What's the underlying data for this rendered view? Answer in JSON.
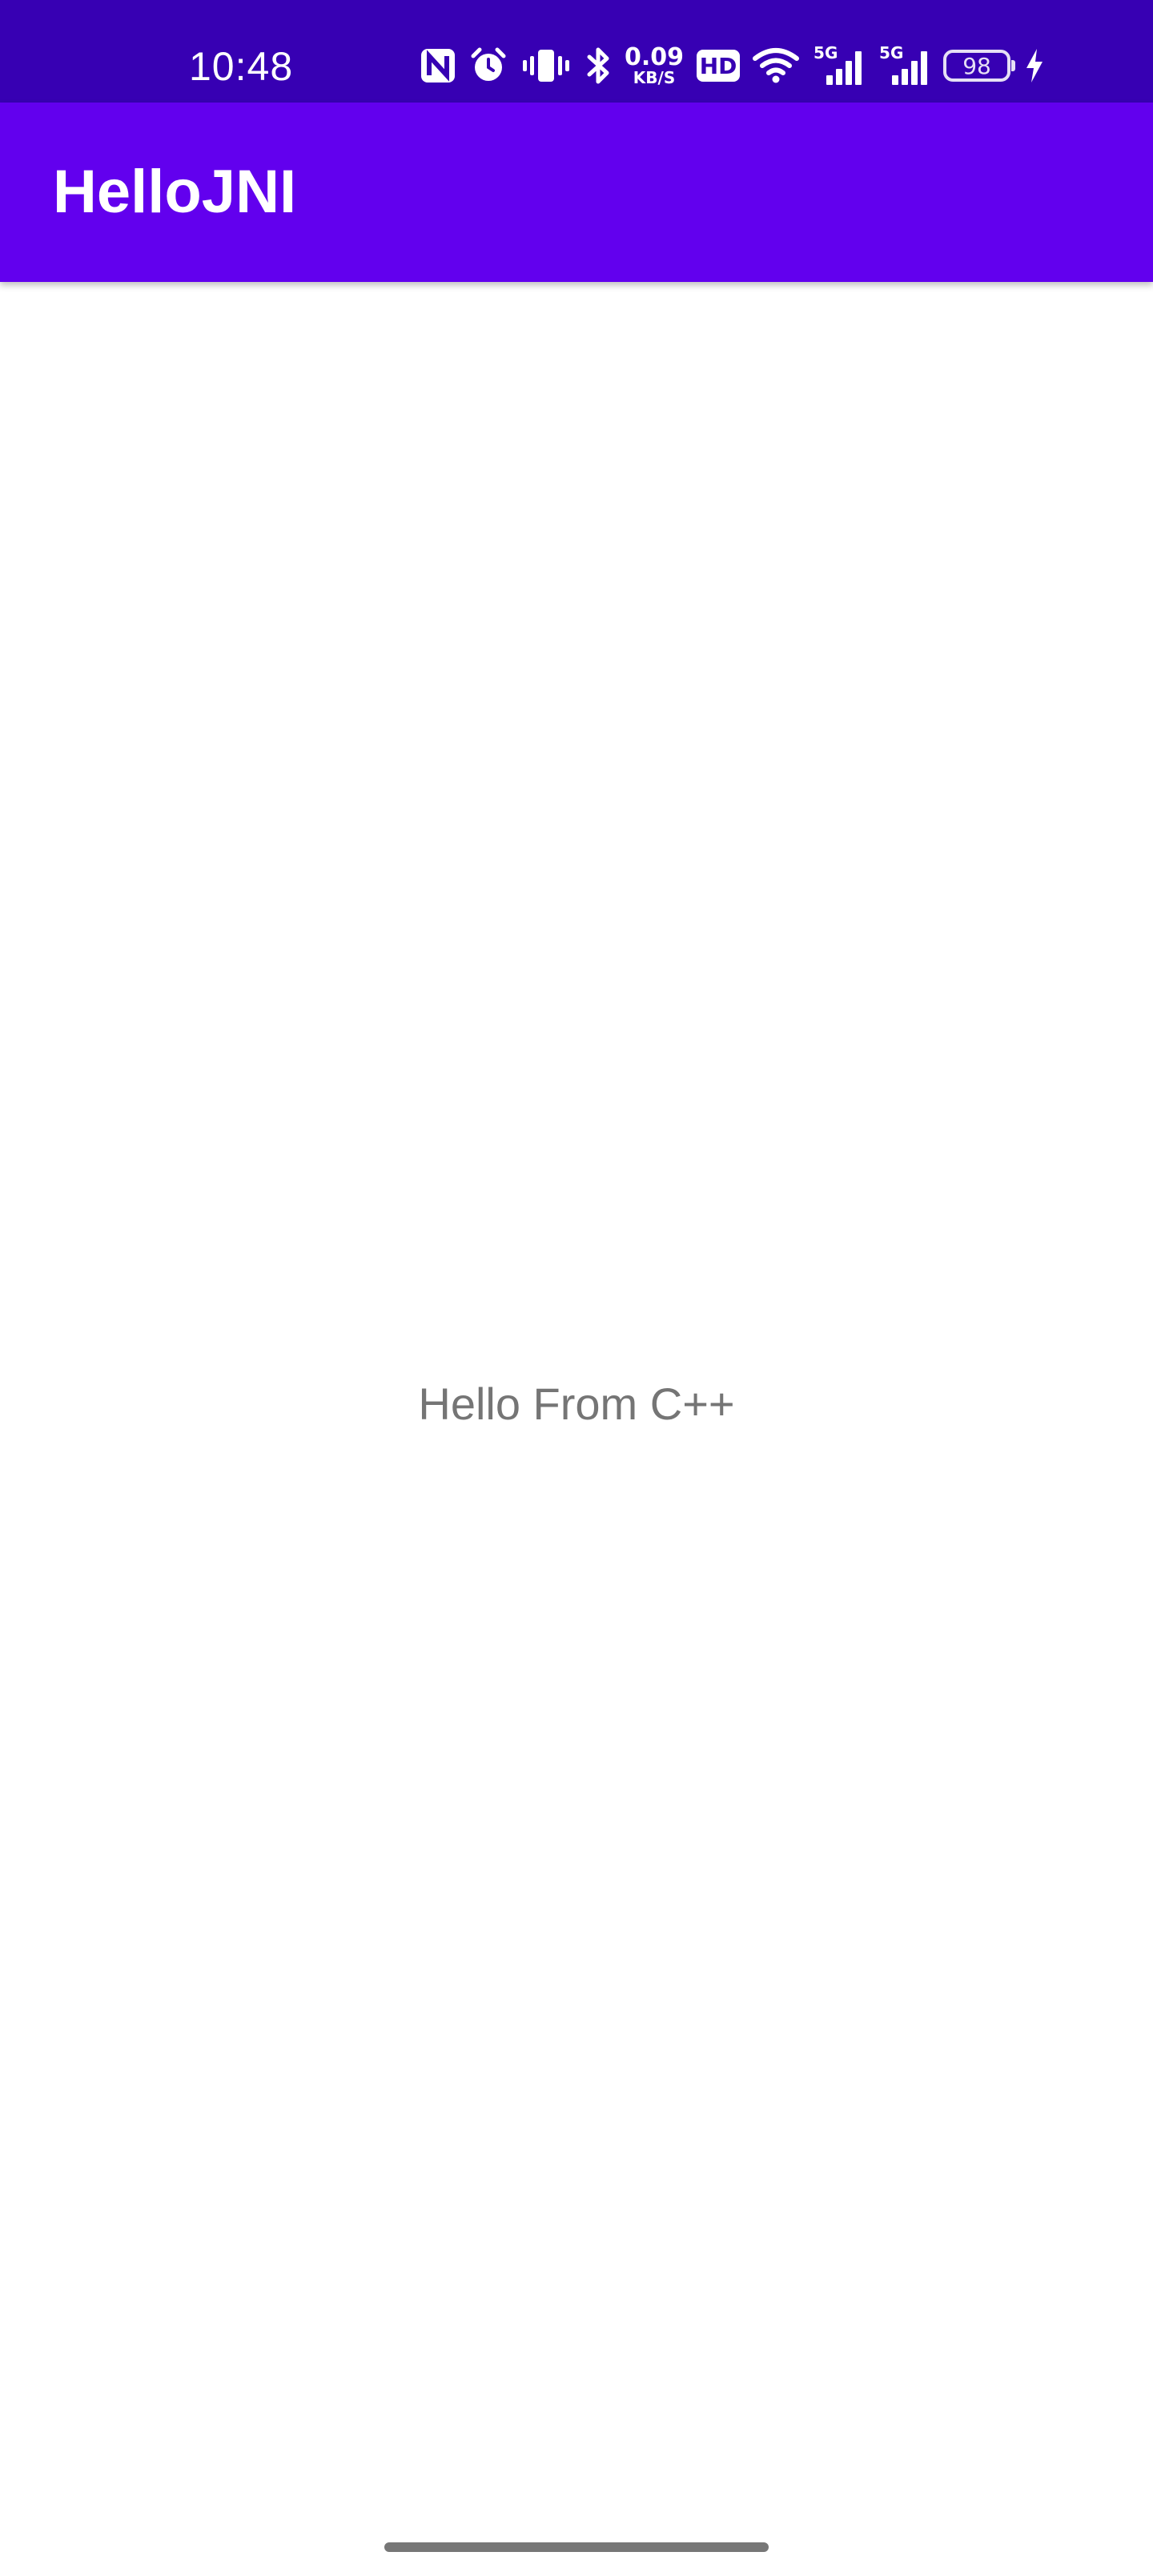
{
  "status_bar": {
    "time": "10:48",
    "network_speed_value": "0.09",
    "network_speed_unit": "KB/S",
    "hd_label": "HD",
    "sim1_label": "5G",
    "sim2_label": "5G",
    "battery_level": "98",
    "icons": [
      "nfc-icon",
      "alarm-icon",
      "vibrate-icon",
      "bluetooth-icon",
      "hd-voice-icon",
      "wifi-icon",
      "signal-icon",
      "signal-icon",
      "battery-icon",
      "charging-icon"
    ],
    "background_color": "#3700b3"
  },
  "app_bar": {
    "title": "HelloJNI",
    "background_color": "#6200ee"
  },
  "main": {
    "message": "Hello From C++",
    "text_color": "#757575"
  }
}
